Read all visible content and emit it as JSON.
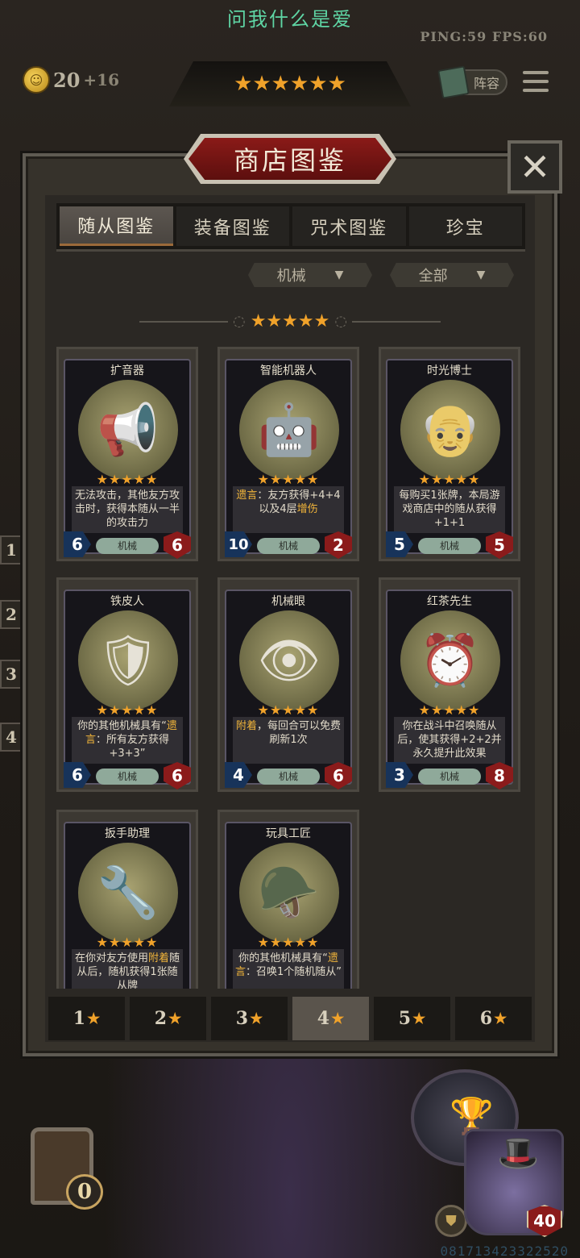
{
  "header": {
    "title": "问我什么是爱",
    "ping_fps": "PING:59  FPS:60",
    "coins": "20",
    "coin_income": "+16",
    "tier_stars": "★★★★★★",
    "lineup_label": "阵容"
  },
  "panel": {
    "title": "商店图鉴",
    "close_label": "✕",
    "tabs": [
      "随从图鉴",
      "装备图鉴",
      "咒术图鉴",
      "珍宝"
    ],
    "active_tab": 0,
    "filter_tribe": "机械",
    "filter_all": "全部",
    "section_stars": "★★★★★"
  },
  "cards": [
    {
      "name": "扩音器",
      "desc": "无法攻击，其他友方攻击时，获得本随从一半的攻击力",
      "tag": "机械",
      "attack": "6",
      "health": "6",
      "stars": "★★★★★",
      "icon": "📢"
    },
    {
      "name": "智能机器人",
      "desc_parts": [
        "遗言",
        "：友方获得+4+4以及4层",
        "增伤"
      ],
      "tag": "机械",
      "attack": "10",
      "health": "2",
      "stars": "★★★★★",
      "icon": "🤖"
    },
    {
      "name": "时光博士",
      "desc": "每购买1张牌，本局游戏商店中的随从获得+1+1",
      "tag": "机械",
      "attack": "5",
      "health": "5",
      "stars": "★★★★★",
      "icon": "👴"
    },
    {
      "name": "铁皮人",
      "desc_parts": [
        "你的其他机械具有“",
        "遗言",
        "：所有友方获得+3+3”"
      ],
      "tag": "机械",
      "attack": "6",
      "health": "6",
      "stars": "★★★★★",
      "icon": "🛡"
    },
    {
      "name": "机械眼",
      "desc_parts": [
        "附着",
        "，每回合可以免费刷新1次"
      ],
      "tag": "机械",
      "attack": "4",
      "health": "6",
      "stars": "★★★★★",
      "icon": "👁"
    },
    {
      "name": "红茶先生",
      "desc": "你在战斗中召唤随从后，使其获得+2+2并永久提升此效果",
      "tag": "机械",
      "attack": "3",
      "health": "8",
      "stars": "★★★★★",
      "icon": "⏰"
    },
    {
      "name": "扳手助理",
      "desc_parts": [
        "在你对友方使用",
        "附着",
        "随从后，随机获得1张随从牌"
      ],
      "stars": "★★★★★",
      "icon": "🔧"
    },
    {
      "name": "玩具工匠",
      "desc_parts": [
        "你的其他机械具有“",
        "遗言",
        "：召唤1个随机随从”"
      ],
      "stars": "★★★★★",
      "icon": "🪖"
    }
  ],
  "star_tabs": [
    "1",
    "2",
    "3",
    "4",
    "5",
    "6"
  ],
  "active_star_tab": 3,
  "bottom": {
    "chest_count": "0",
    "hero_health": "40",
    "user_id": "081713423322520"
  },
  "side_slots": [
    "1",
    "2",
    "3",
    "4"
  ],
  "colors": {
    "accent_star": "#f0a22a",
    "title_red": "#8a1a18",
    "highlight": "#f2b53a",
    "attack_blue": "#17335a",
    "health_red": "#8b1b1b"
  }
}
